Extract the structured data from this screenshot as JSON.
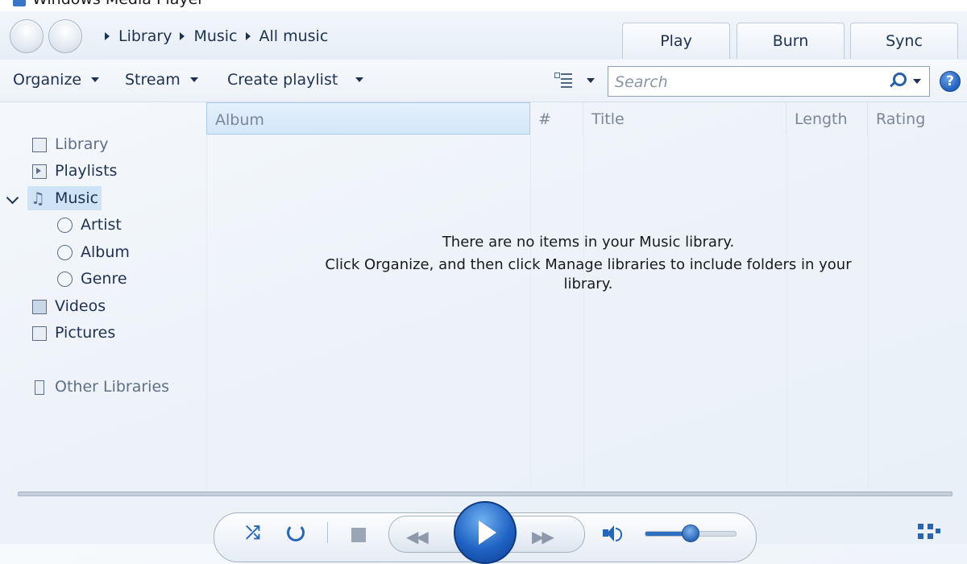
{
  "window": {
    "title": "Windows Media Player"
  },
  "navigation": {
    "breadcrumb": [
      "Library",
      "Music",
      "All music"
    ],
    "tabs": [
      "Play",
      "Burn",
      "Sync"
    ]
  },
  "toolbar": {
    "organize": "Organize",
    "stream": "Stream",
    "create_playlist": "Create playlist",
    "search_placeholder": "Search",
    "help": "?"
  },
  "sidebar": {
    "items": [
      {
        "label": "Library",
        "icon": "library-icon"
      },
      {
        "label": "Playlists",
        "icon": "playlist-icon"
      },
      {
        "label": "Music",
        "icon": "music-note-icon",
        "selected": true
      },
      {
        "label": "Artist",
        "icon": "artist-icon"
      },
      {
        "label": "Album",
        "icon": "album-icon"
      },
      {
        "label": "Genre",
        "icon": "genre-icon"
      },
      {
        "label": "Videos",
        "icon": "video-icon"
      },
      {
        "label": "Pictures",
        "icon": "picture-icon"
      },
      {
        "label": "Other Libraries",
        "icon": "other-libraries-icon"
      }
    ]
  },
  "columns": [
    "Album",
    "#",
    "Title",
    "Length",
    "Rating"
  ],
  "empty_message": {
    "line1": "There are no items in your Music library.",
    "line2": "Click Organize, and then click Manage libraries to include folders in your",
    "line3": "library."
  },
  "player": {
    "volume_level": 0.5,
    "accent_color": "#2566b8"
  }
}
